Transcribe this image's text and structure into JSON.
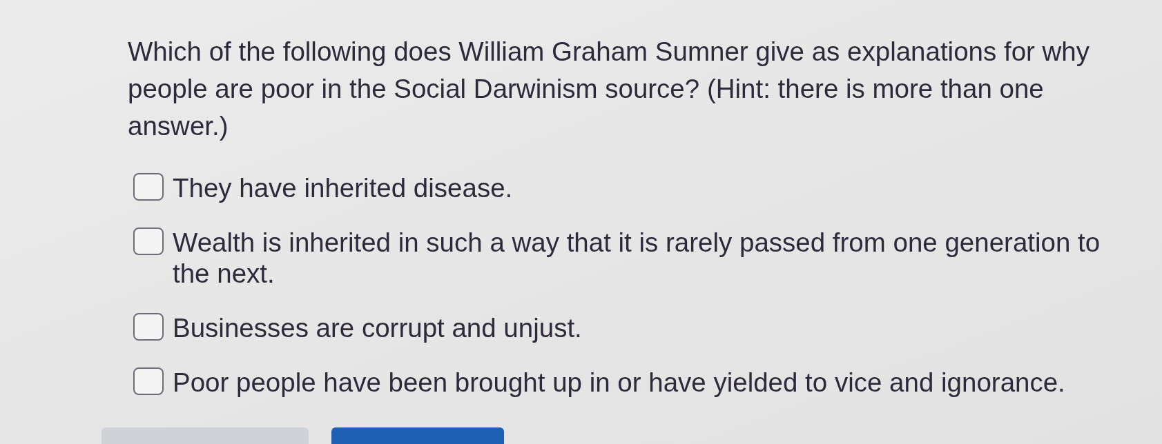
{
  "question": {
    "text": "Which of the following does William Graham Sumner give as explanations for why people are poor in the Social Darwinism source? (Hint: there is more than one answer.)"
  },
  "options": [
    {
      "label": "They have inherited disease.",
      "checked": false
    },
    {
      "label": "Wealth is inherited in such a way that it is rarely passed from one generation to the next.",
      "checked": false
    },
    {
      "label": "Businesses are corrupt and unjust.",
      "checked": false
    },
    {
      "label": "Poor people have been brought up in or have yielded to vice and ignorance.",
      "checked": false
    }
  ],
  "buttons": [
    {
      "kind": "secondary"
    },
    {
      "kind": "primary"
    }
  ]
}
